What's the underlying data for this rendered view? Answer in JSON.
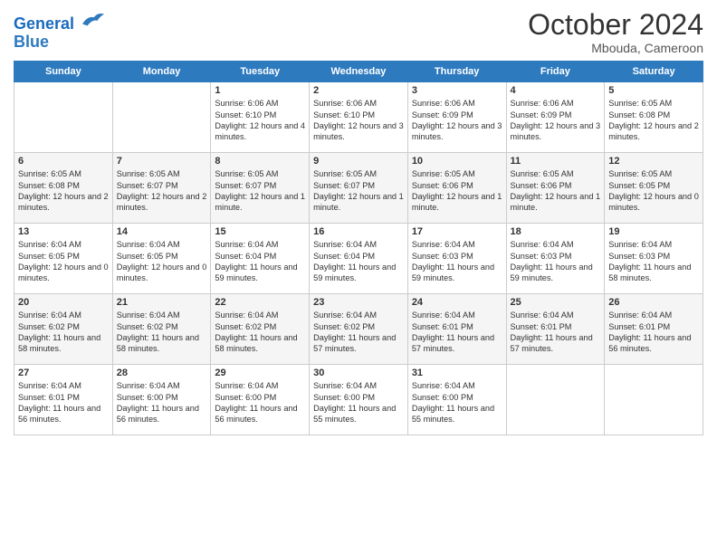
{
  "header": {
    "logo_line1": "General",
    "logo_line2": "Blue",
    "month": "October 2024",
    "location": "Mbouda, Cameroon"
  },
  "weekdays": [
    "Sunday",
    "Monday",
    "Tuesday",
    "Wednesday",
    "Thursday",
    "Friday",
    "Saturday"
  ],
  "weeks": [
    [
      {
        "day": "",
        "info": ""
      },
      {
        "day": "",
        "info": ""
      },
      {
        "day": "1",
        "info": "Sunrise: 6:06 AM\nSunset: 6:10 PM\nDaylight: 12 hours and 4 minutes."
      },
      {
        "day": "2",
        "info": "Sunrise: 6:06 AM\nSunset: 6:10 PM\nDaylight: 12 hours and 3 minutes."
      },
      {
        "day": "3",
        "info": "Sunrise: 6:06 AM\nSunset: 6:09 PM\nDaylight: 12 hours and 3 minutes."
      },
      {
        "day": "4",
        "info": "Sunrise: 6:06 AM\nSunset: 6:09 PM\nDaylight: 12 hours and 3 minutes."
      },
      {
        "day": "5",
        "info": "Sunrise: 6:05 AM\nSunset: 6:08 PM\nDaylight: 12 hours and 2 minutes."
      }
    ],
    [
      {
        "day": "6",
        "info": "Sunrise: 6:05 AM\nSunset: 6:08 PM\nDaylight: 12 hours and 2 minutes."
      },
      {
        "day": "7",
        "info": "Sunrise: 6:05 AM\nSunset: 6:07 PM\nDaylight: 12 hours and 2 minutes."
      },
      {
        "day": "8",
        "info": "Sunrise: 6:05 AM\nSunset: 6:07 PM\nDaylight: 12 hours and 1 minute."
      },
      {
        "day": "9",
        "info": "Sunrise: 6:05 AM\nSunset: 6:07 PM\nDaylight: 12 hours and 1 minute."
      },
      {
        "day": "10",
        "info": "Sunrise: 6:05 AM\nSunset: 6:06 PM\nDaylight: 12 hours and 1 minute."
      },
      {
        "day": "11",
        "info": "Sunrise: 6:05 AM\nSunset: 6:06 PM\nDaylight: 12 hours and 1 minute."
      },
      {
        "day": "12",
        "info": "Sunrise: 6:05 AM\nSunset: 6:05 PM\nDaylight: 12 hours and 0 minutes."
      }
    ],
    [
      {
        "day": "13",
        "info": "Sunrise: 6:04 AM\nSunset: 6:05 PM\nDaylight: 12 hours and 0 minutes."
      },
      {
        "day": "14",
        "info": "Sunrise: 6:04 AM\nSunset: 6:05 PM\nDaylight: 12 hours and 0 minutes."
      },
      {
        "day": "15",
        "info": "Sunrise: 6:04 AM\nSunset: 6:04 PM\nDaylight: 11 hours and 59 minutes."
      },
      {
        "day": "16",
        "info": "Sunrise: 6:04 AM\nSunset: 6:04 PM\nDaylight: 11 hours and 59 minutes."
      },
      {
        "day": "17",
        "info": "Sunrise: 6:04 AM\nSunset: 6:03 PM\nDaylight: 11 hours and 59 minutes."
      },
      {
        "day": "18",
        "info": "Sunrise: 6:04 AM\nSunset: 6:03 PM\nDaylight: 11 hours and 59 minutes."
      },
      {
        "day": "19",
        "info": "Sunrise: 6:04 AM\nSunset: 6:03 PM\nDaylight: 11 hours and 58 minutes."
      }
    ],
    [
      {
        "day": "20",
        "info": "Sunrise: 6:04 AM\nSunset: 6:02 PM\nDaylight: 11 hours and 58 minutes."
      },
      {
        "day": "21",
        "info": "Sunrise: 6:04 AM\nSunset: 6:02 PM\nDaylight: 11 hours and 58 minutes."
      },
      {
        "day": "22",
        "info": "Sunrise: 6:04 AM\nSunset: 6:02 PM\nDaylight: 11 hours and 58 minutes."
      },
      {
        "day": "23",
        "info": "Sunrise: 6:04 AM\nSunset: 6:02 PM\nDaylight: 11 hours and 57 minutes."
      },
      {
        "day": "24",
        "info": "Sunrise: 6:04 AM\nSunset: 6:01 PM\nDaylight: 11 hours and 57 minutes."
      },
      {
        "day": "25",
        "info": "Sunrise: 6:04 AM\nSunset: 6:01 PM\nDaylight: 11 hours and 57 minutes."
      },
      {
        "day": "26",
        "info": "Sunrise: 6:04 AM\nSunset: 6:01 PM\nDaylight: 11 hours and 56 minutes."
      }
    ],
    [
      {
        "day": "27",
        "info": "Sunrise: 6:04 AM\nSunset: 6:01 PM\nDaylight: 11 hours and 56 minutes."
      },
      {
        "day": "28",
        "info": "Sunrise: 6:04 AM\nSunset: 6:00 PM\nDaylight: 11 hours and 56 minutes."
      },
      {
        "day": "29",
        "info": "Sunrise: 6:04 AM\nSunset: 6:00 PM\nDaylight: 11 hours and 56 minutes."
      },
      {
        "day": "30",
        "info": "Sunrise: 6:04 AM\nSunset: 6:00 PM\nDaylight: 11 hours and 55 minutes."
      },
      {
        "day": "31",
        "info": "Sunrise: 6:04 AM\nSunset: 6:00 PM\nDaylight: 11 hours and 55 minutes."
      },
      {
        "day": "",
        "info": ""
      },
      {
        "day": "",
        "info": ""
      }
    ]
  ]
}
